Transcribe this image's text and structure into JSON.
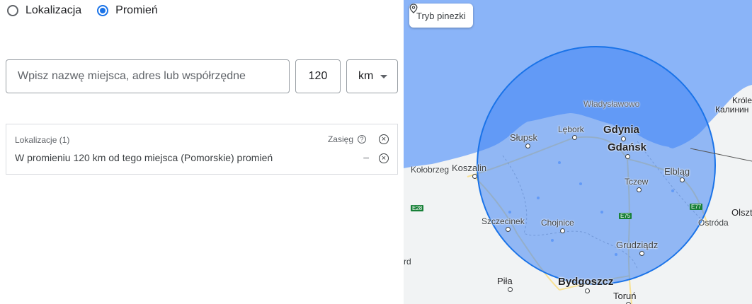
{
  "targeting": {
    "options": [
      {
        "label": "Lokalizacja",
        "selected": false
      },
      {
        "label": "Promień",
        "selected": true
      }
    ]
  },
  "inputs": {
    "place_placeholder": "Wpisz nazwę miejsca, adres lub współrzędne",
    "radius_value": "120",
    "unit_value": "km"
  },
  "locations_panel": {
    "header": "Lokalizacje (1)",
    "range_label": "Zasięg",
    "row_text": "W promieniu 120 km od tego miejsca (Pomorskie) promień",
    "row_range": "–"
  },
  "map": {
    "pin_mode_label": "Tryb pinezki",
    "colors": {
      "sea": "#8ab4f8",
      "land": "#f1f3f4",
      "radius_fill": "#4285f4",
      "radius_stroke": "#1a73e8"
    },
    "cities": [
      {
        "name": "Władysławowo"
      },
      {
        "name": "Słupsk"
      },
      {
        "name": "Lębork"
      },
      {
        "name": "Gdynia"
      },
      {
        "name": "Gdańsk"
      },
      {
        "name": "Kołobrzeg"
      },
      {
        "name": "Koszalin"
      },
      {
        "name": "Tczew"
      },
      {
        "name": "Elbląg"
      },
      {
        "name": "Szczecinek"
      },
      {
        "name": "Chojnice"
      },
      {
        "name": "Grudziądz"
      },
      {
        "name": "Piła"
      },
      {
        "name": "Bydgoszcz"
      },
      {
        "name": "Toruń"
      },
      {
        "name": "Ostróda"
      },
      {
        "name": "Olszt"
      },
      {
        "name": "Królew"
      },
      {
        "name": "Калинин"
      },
      {
        "name": "rd"
      }
    ],
    "roads": [
      {
        "label": "E28"
      },
      {
        "label": "E75"
      },
      {
        "label": "E77"
      }
    ]
  }
}
